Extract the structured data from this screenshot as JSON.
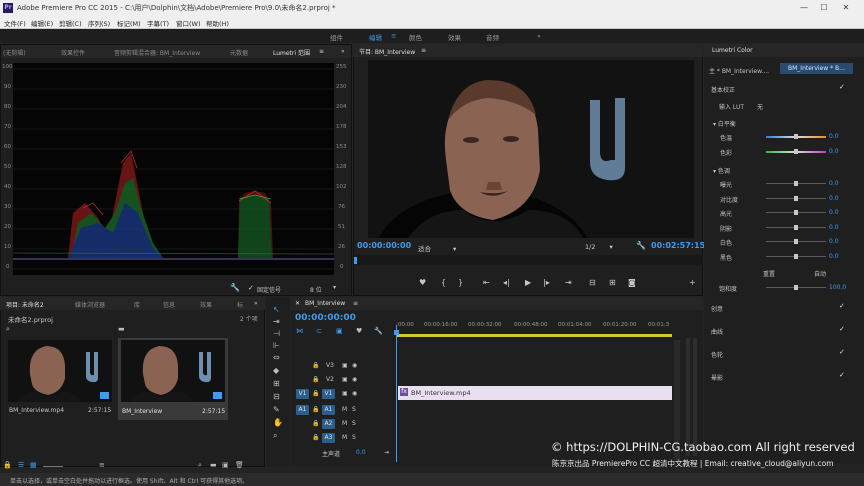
{
  "window": {
    "title": "Adobe Premiere Pro CC 2015 - C:\\用户\\Dolphin\\文档\\Adobe\\Premiere Pro\\9.0\\未命名2.prproj *",
    "app_icon": "Pr"
  },
  "menu": [
    "文件(F)",
    "编辑(E)",
    "剪辑(C)",
    "序列(S)",
    "标记(M)",
    "字幕(T)",
    "窗口(W)",
    "帮助(H)"
  ],
  "workspaces": {
    "items": [
      "组件",
      "编辑",
      "颜色",
      "效果",
      "音频"
    ],
    "active": "编辑",
    "more": "»"
  },
  "scopes_panel": {
    "tabs": [
      "(无剪辑)",
      "效果控件",
      "音频剪辑混合器: BM_Interview",
      "元数据",
      "Lumetri 范围"
    ],
    "active_tab": "Lumetri 范围",
    "left_axis": [
      "100",
      "90",
      "80",
      "70",
      "60",
      "50",
      "40",
      "30",
      "20",
      "10",
      "0"
    ],
    "right_axis": [
      "255",
      "230",
      "204",
      "178",
      "153",
      "128",
      "102",
      "76",
      "51",
      "26",
      "0"
    ],
    "clamp_label": "固定信号",
    "bit_label": "8 位"
  },
  "program_monitor": {
    "tab": "节目: BM_Interview",
    "menu_icon": "≡",
    "timecode_current": "00:00:00:00",
    "fit": "适合",
    "ratio": "1/2",
    "timecode_duration": "00:02:57:15"
  },
  "lumetri": {
    "tab": "Lumetri Color",
    "clip_main": "主 * BM_Interview....",
    "clip_seq": "BM_Interview * B...",
    "basic": "基本校正",
    "lut_label": "输入 LUT",
    "lut_value": "无",
    "wb_section": "白平衡",
    "wb_rows": [
      {
        "label": "色温",
        "value": "0.0",
        "pos": 0.5
      },
      {
        "label": "色彩",
        "value": "0.0",
        "pos": 0.5
      }
    ],
    "tone_section": "色调",
    "tone_rows": [
      {
        "label": "曝光",
        "value": "0.0",
        "pos": 0.5
      },
      {
        "label": "对比度",
        "value": "0.0",
        "pos": 0.5
      },
      {
        "label": "高光",
        "value": "0.0",
        "pos": 0.5
      },
      {
        "label": "阴影",
        "value": "0.0",
        "pos": 0.5
      },
      {
        "label": "白色",
        "value": "0.0",
        "pos": 0.5
      },
      {
        "label": "黑色",
        "value": "0.0",
        "pos": 0.5
      }
    ],
    "reset": "重置",
    "auto": "自动",
    "saturation": {
      "label": "饱和度",
      "value": "100.0",
      "pos": 0.5
    },
    "sections": [
      "创意",
      "曲线",
      "色轮",
      "晕影"
    ]
  },
  "project_panel": {
    "tabs": [
      "项目: 未命名2",
      "媒体浏览器",
      "库",
      "信息",
      "效果",
      "标"
    ],
    "project_file": "未命名2.prproj",
    "item_count": "2 个项",
    "items": [
      {
        "name": "BM_Interview.mp4",
        "duration": "2:57:15"
      },
      {
        "name": "BM_Interview",
        "duration": "2:57:15"
      }
    ]
  },
  "timeline": {
    "tab": "BM_Interview",
    "timecode": "00:00:00:00",
    "ruler": [
      ":00:00",
      "00:00:16:00",
      "00:00:32:00",
      "00:00:48:00",
      "00:01:04:00",
      "00:01:20:00",
      "00:01:3"
    ],
    "video_tracks": [
      "V3",
      "V2",
      "V1"
    ],
    "audio_tracks": [
      "A1",
      "A2",
      "A3"
    ],
    "master": "主声道",
    "master_value": "0.0",
    "clip_name": "BM_Interview.mp4"
  },
  "status": "单击以选择，或单击空白处并拖动以进行框选。使用 Shift、Alt 和 Ctrl 可获得其他选项。",
  "watermark": {
    "line1": "© https://DOLPHIN-CG.taobao.com  All right reserved",
    "line2": "陈京京出品 PremierePro CC 超清中文教程 | Email: creative_cloud@aliyun.com"
  },
  "colors": {
    "accent": "#3d9bf0",
    "panel_bg": "#1f1f1f",
    "clip": "#e8dff0",
    "workarea": "#d6c62a"
  }
}
